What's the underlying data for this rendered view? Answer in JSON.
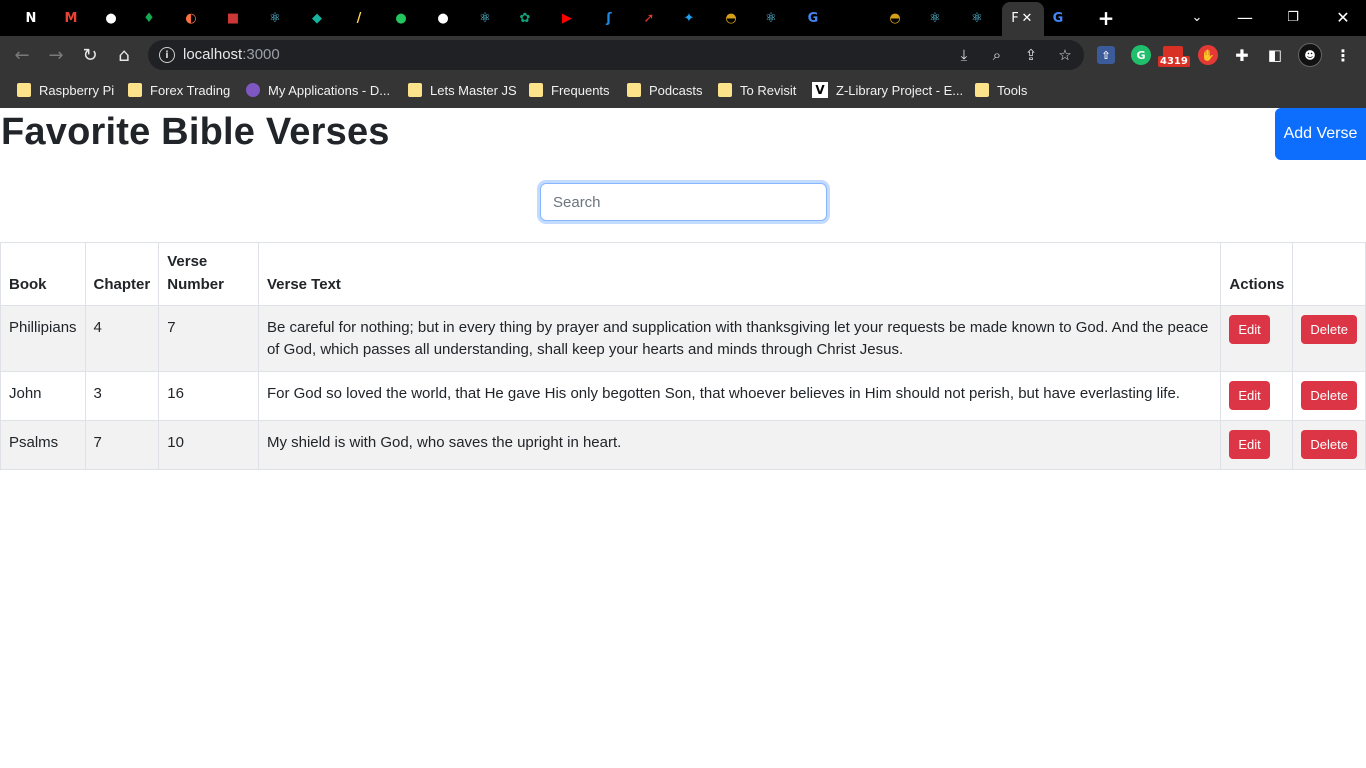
{
  "browser": {
    "url_host": "localhost",
    "url_port": ":3000",
    "active_tab_letter": "F",
    "tab_close_glyph": "✕",
    "new_tab_glyph": "+",
    "mail_badge": "4319",
    "tab_favicons": [
      "notion-icon",
      "gmail-icon",
      "github-icon",
      "mongodb-icon",
      "app-icon",
      "npm-icon",
      "react-icon",
      "diamond-icon",
      "ai-icon",
      "app2-icon",
      "github-icon",
      "react-icon",
      "openai-icon",
      "youtube-icon",
      "app3-icon",
      "pin-icon",
      "twitter-icon",
      "eye-icon",
      "react-icon",
      "google-icon",
      "blank-icon",
      "eye-icon",
      "react-icon",
      "react-icon"
    ]
  },
  "bookmarks": [
    {
      "label": "Raspberry Pi",
      "icon": "folder-icon"
    },
    {
      "label": "Forex Trading",
      "icon": "folder-icon"
    },
    {
      "label": "My Applications - D...",
      "icon": "app-icon"
    },
    {
      "label": "Lets Master JS",
      "icon": "folder-icon"
    },
    {
      "label": "Frequents",
      "icon": "folder-icon"
    },
    {
      "label": "Podcasts",
      "icon": "folder-icon"
    },
    {
      "label": "To Revisit",
      "icon": "folder-icon"
    },
    {
      "label": "Z-Library Project - E...",
      "icon": "v-icon"
    },
    {
      "label": "Tools",
      "icon": "folder-icon"
    }
  ],
  "page": {
    "title": "Favorite Bible Verses",
    "add_button": "Add Verse",
    "search_placeholder": "Search",
    "search_value": ""
  },
  "table": {
    "headers": {
      "book": "Book",
      "chapter": "Chapter",
      "verse_number_line1": "Verse",
      "verse_number_line2": "Number",
      "verse_text": "Verse Text",
      "actions": "Actions"
    },
    "edit_label": "Edit",
    "delete_label": "Delete",
    "rows": [
      {
        "book": "Phillipians",
        "chapter": "4",
        "verse": "7",
        "text": "Be careful for nothing; but in every thing by prayer and supplication with thanksgiving let your requests be made known to God. And the peace of God, which passes all understanding, shall keep your hearts and minds through Christ Jesus."
      },
      {
        "book": "John",
        "chapter": "3",
        "verse": "16",
        "text": "For God so loved the world, that He gave His only begotten Son, that whoever believes in Him should not perish, but have everlasting life."
      },
      {
        "book": "Psalms",
        "chapter": "7",
        "verse": "10",
        "text": "My shield is with God, who saves the upright in heart."
      }
    ]
  },
  "colors": {
    "primary": "#0d6efd",
    "danger": "#dc3545",
    "text": "#212529",
    "stripe": "#f2f2f2"
  }
}
